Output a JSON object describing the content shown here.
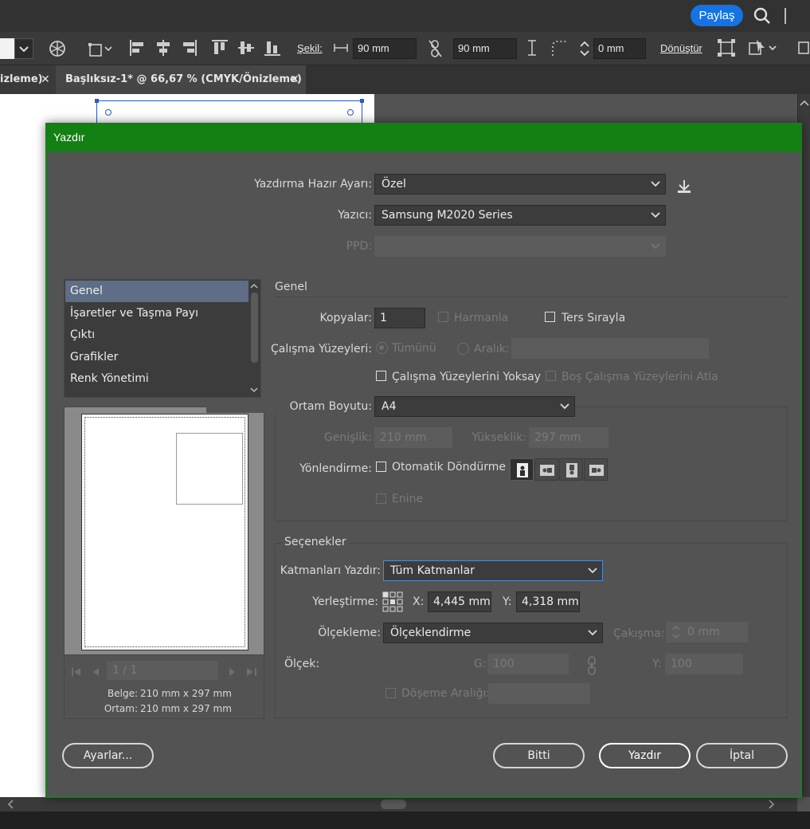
{
  "app": {
    "share_label": "Paylaş",
    "control_bar": {
      "shape_label": "Şekil:",
      "width_value": "90 mm",
      "height_value": "90 mm",
      "corner_value": "0 mm",
      "transform_label": "Dönüştür"
    },
    "tabs": [
      {
        "label": "izleme)"
      },
      {
        "label": "Başlıksız-1* @ 66,67 % (CMYK/Önizleme)"
      }
    ]
  },
  "dialog": {
    "title": "Yazdır",
    "preset_label": "Yazdırma Hazır Ayarı:",
    "preset_value": "Özel",
    "printer_label": "Yazıcı:",
    "printer_value": "Samsung M2020 Series",
    "ppd_label": "PPD:",
    "categories": [
      {
        "label": "Genel",
        "active": true
      },
      {
        "label": "İşaretler ve Taşma Payı"
      },
      {
        "label": "Çıktı"
      },
      {
        "label": "Grafikler"
      },
      {
        "label": "Renk Yönetimi"
      }
    ],
    "preview": {
      "page_indicator": "1 / 1",
      "document_label": "Belge:",
      "document_value": "210 mm x 297 mm",
      "media_label": "Ortam:",
      "media_value": "210 mm x 297 mm"
    },
    "general": {
      "section_title": "Genel",
      "copies_label": "Kopyalar:",
      "copies_value": "1",
      "collate_label": "Harmanla",
      "reverse_label": "Ters Sırayla",
      "artboards_label": "Çalışma Yüzeyleri:",
      "all_label": "Tümünü",
      "range_label": "Aralık:",
      "ignore_artboards_label": "Çalışma Yüzeylerini Yoksay",
      "skip_blank_label": "Boş Çalışma Yüzeylerini Atla",
      "media_size_label": "Ortam Boyutu:",
      "media_size_value": "A4",
      "width_label": "Genişlik:",
      "width_value": "210 mm",
      "height_label": "Yükseklik:",
      "height_value": "297 mm",
      "orientation_label": "Yönlendirme:",
      "auto_rotate_label": "Otomatik Döndürme",
      "transverse_label": "Enine"
    },
    "options": {
      "section_title": "Seçenekler",
      "print_layers_label": "Katmanları Yazdır:",
      "print_layers_value": "Tüm Katmanlar",
      "placement_label": "Yerleştirme:",
      "x_label": "X:",
      "x_value": "4,445 mm",
      "y_label": "Y:",
      "y_value": "4,318 mm",
      "scaling_label": "Ölçekleme:",
      "scaling_value": "Ölçeklendirme",
      "overlap_label": "Çakışma:",
      "overlap_value": "0 mm",
      "scale_label": "Ölçek:",
      "scale_w_label": "G:",
      "scale_w_value": "100",
      "scale_h_label": "Y:",
      "scale_h_value": "100",
      "tile_range_label": "Döşeme Aralığı:"
    },
    "buttons": {
      "setup": "Ayarlar...",
      "done": "Bitti",
      "print": "Yazdır",
      "cancel": "İptal"
    }
  }
}
